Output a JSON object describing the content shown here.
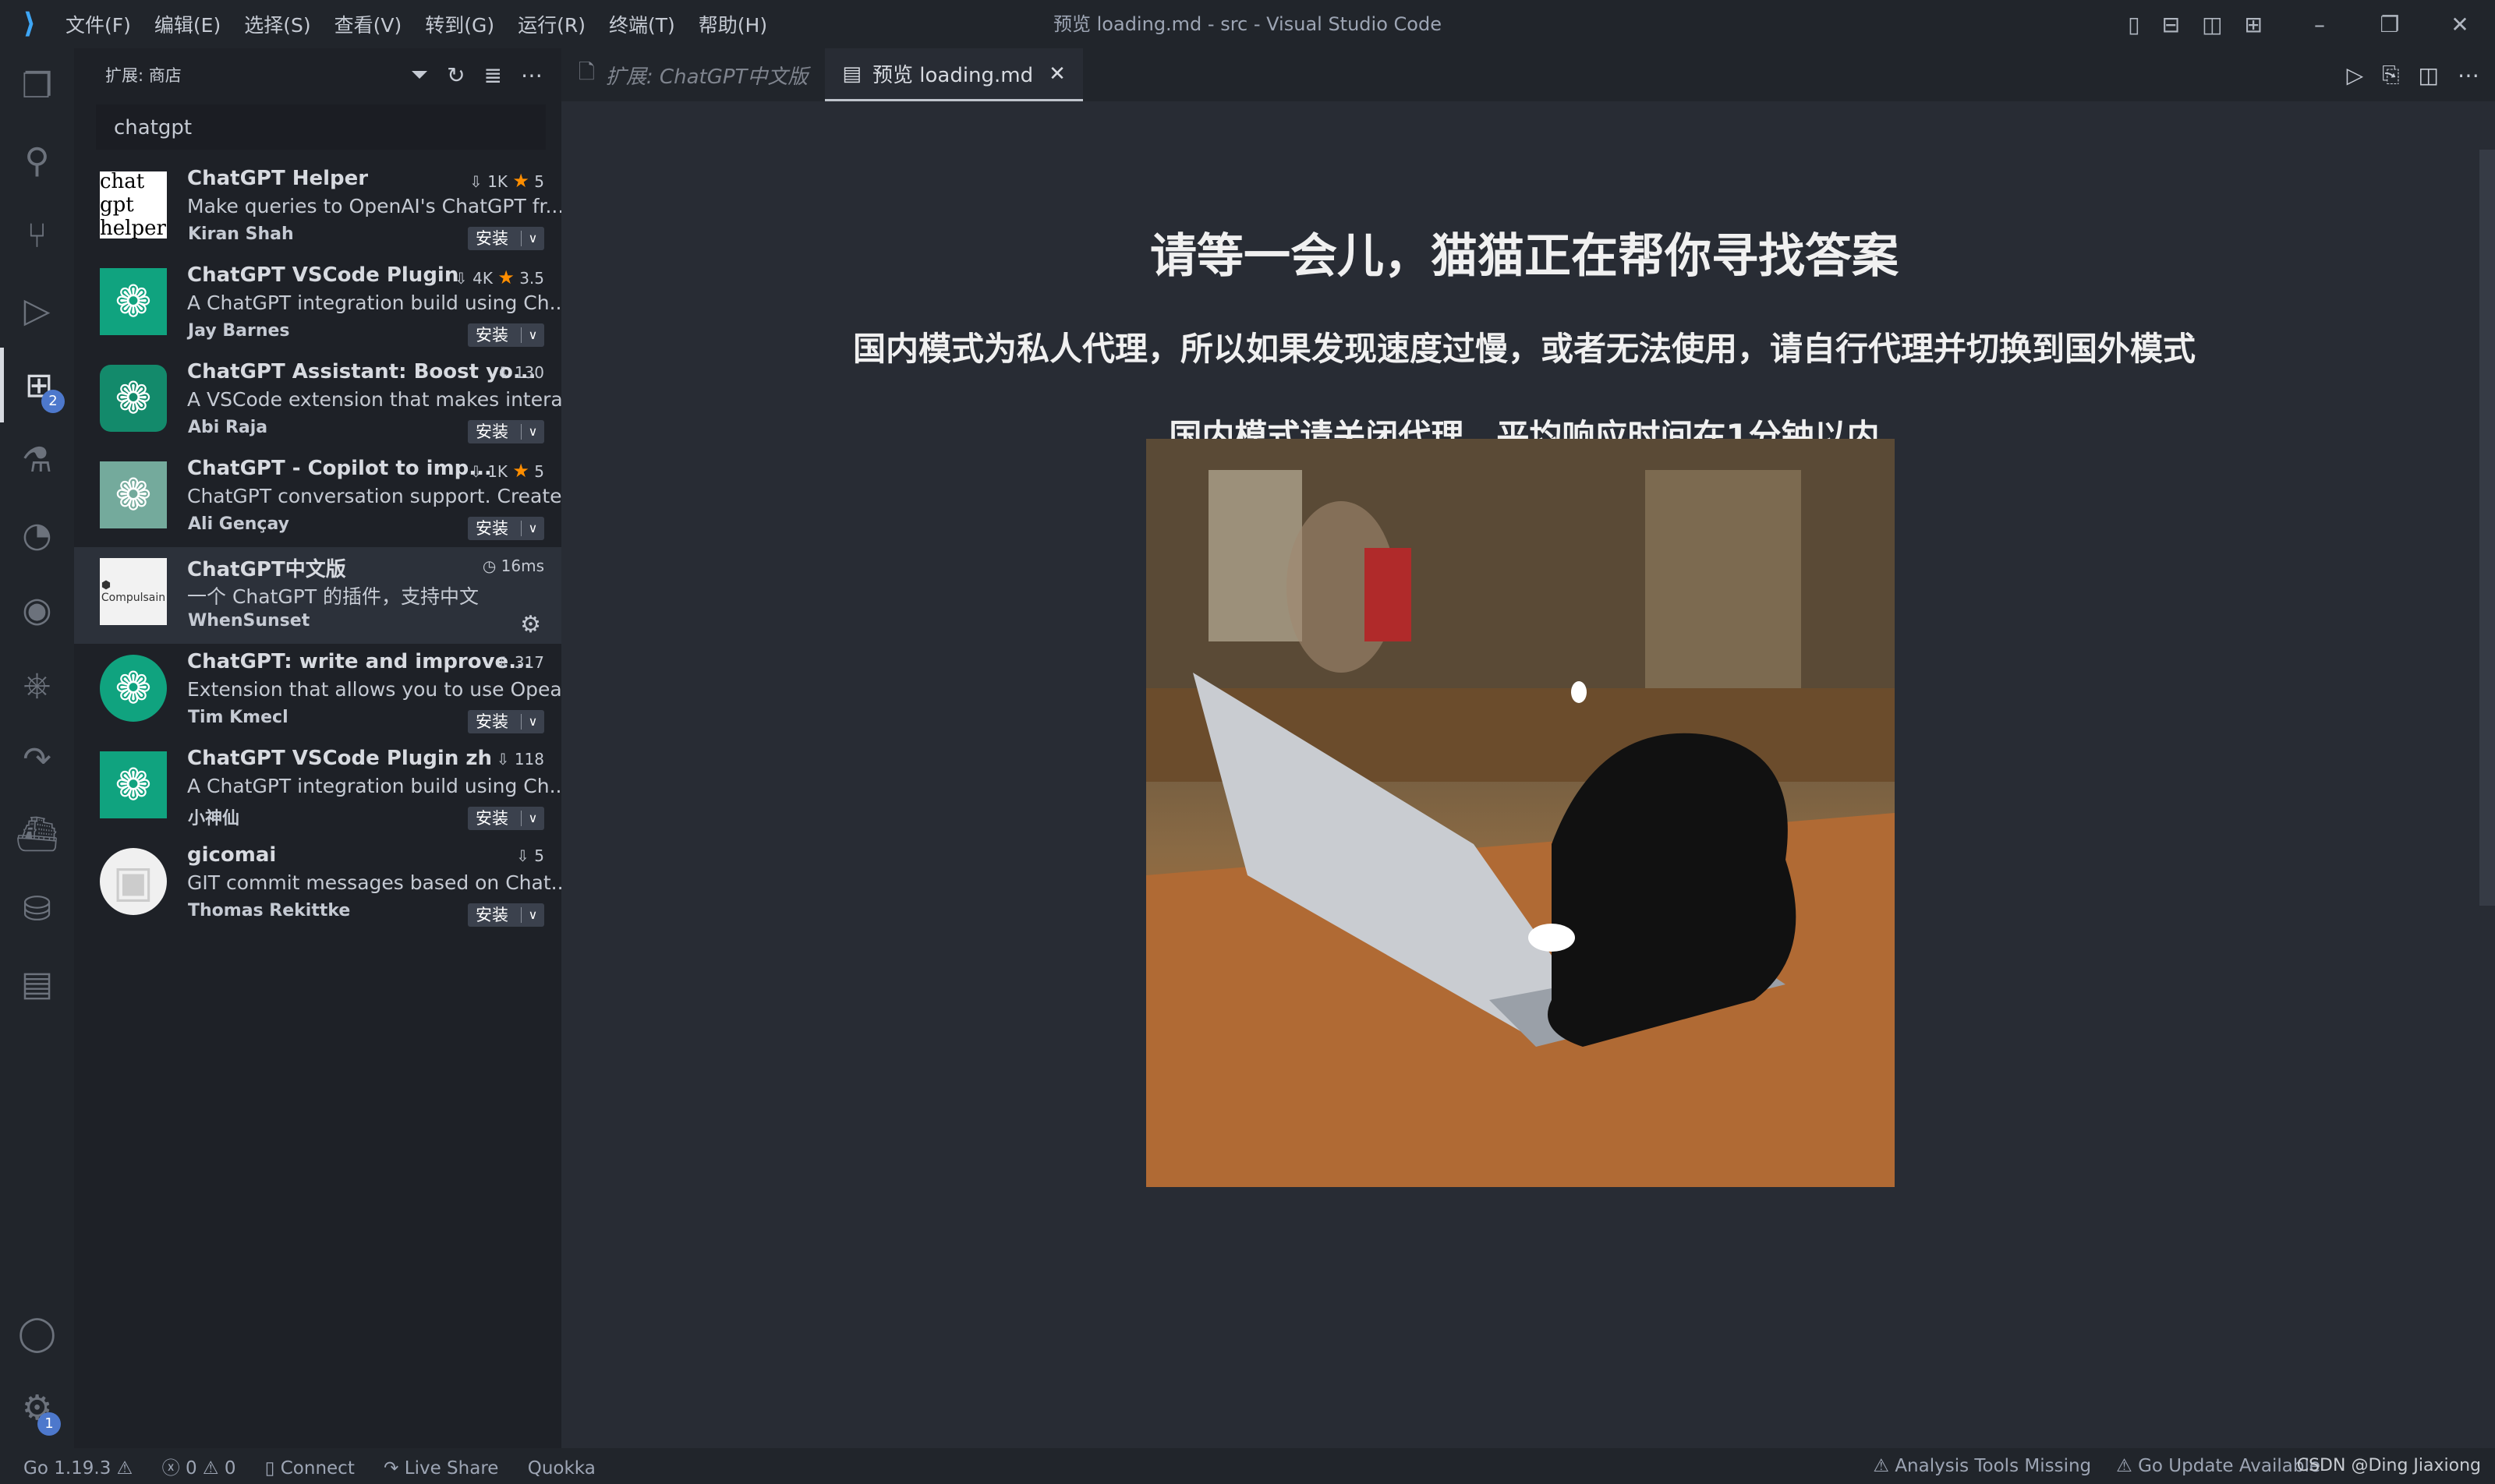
{
  "window": {
    "title": "预览 loading.md - src - Visual Studio Code"
  },
  "menu": [
    "文件(F)",
    "编辑(E)",
    "选择(S)",
    "查看(V)",
    "转到(G)",
    "运行(R)",
    "终端(T)",
    "帮助(H)"
  ],
  "activity_badges": {
    "extensions": "2",
    "settings": "1"
  },
  "sidebar": {
    "title": "扩展: 商店",
    "search_value": "chatgpt",
    "install_label": "安装",
    "extensions": [
      {
        "title": "ChatGPT Helper",
        "desc": "Make queries to OpenAI's ChatGPT fr...",
        "author": "Kiran Shah",
        "downloads": "1K",
        "rating": "5",
        "icon_bg": "#ffffff"
      },
      {
        "title": "ChatGPT VSCode Plugin",
        "desc": "A ChatGPT integration build using Ch...",
        "author": "Jay Barnes",
        "downloads": "4K",
        "rating": "3.5",
        "icon_bg": "#10a37f"
      },
      {
        "title": "ChatGPT Assistant: Boost yo...",
        "desc": "A VSCode extension that makes intera...",
        "author": "Abi Raja",
        "downloads": "130",
        "icon_bg": "#138a6b"
      },
      {
        "title": "ChatGPT - Copilot to imp...",
        "desc": "ChatGPT conversation support. Create...",
        "author": "Ali Gençay",
        "downloads": "1K",
        "rating": "5",
        "icon_bg": "#74aa9c"
      },
      {
        "title": "ChatGPT中文版",
        "desc": "一个 ChatGPT 的插件，支持中文",
        "author": "WhenSunset",
        "time": "16ms",
        "icon_bg": "#f2f2f2",
        "icon_text": "Compulsain"
      },
      {
        "title": "ChatGPT: write and improve...",
        "desc": "Extension that allows you to use Opea...",
        "author": "Tim Kmecl",
        "downloads": "317",
        "icon_bg": "#10a37f"
      },
      {
        "title": "ChatGPT VSCode Plugin zh",
        "desc": "A ChatGPT integration build using Ch...",
        "author": "小神仙",
        "downloads": "118",
        "icon_bg": "#10a37f"
      },
      {
        "title": "gicomai",
        "desc": "GIT commit messages based on Chat...",
        "author": "Thomas Rekittke",
        "downloads": "5",
        "icon_bg": "#f0f0f0"
      }
    ]
  },
  "tabs": [
    {
      "label": "扩展: ChatGPT中文版",
      "active": false
    },
    {
      "label": "预览 loading.md",
      "active": true
    }
  ],
  "preview": {
    "heading": "请等一会儿，猫猫正在帮你寻找答案",
    "line1": "国内模式为私人代理，所以如果发现速度过慢，或者无法使用，请自行代理并切换到国外模式",
    "line2": "国内模式请关闭代理，平均响应时间在1分钟以内"
  },
  "status": {
    "go_version": "Go 1.19.3",
    "errors": "0",
    "warnings": "0",
    "connect": "Connect",
    "live_share": "Live Share",
    "quokka": "Quokka",
    "analysis": "Analysis Tools Missing",
    "go_update": "Go Update Available"
  },
  "watermark": "CSDN @Ding Jiaxiong"
}
